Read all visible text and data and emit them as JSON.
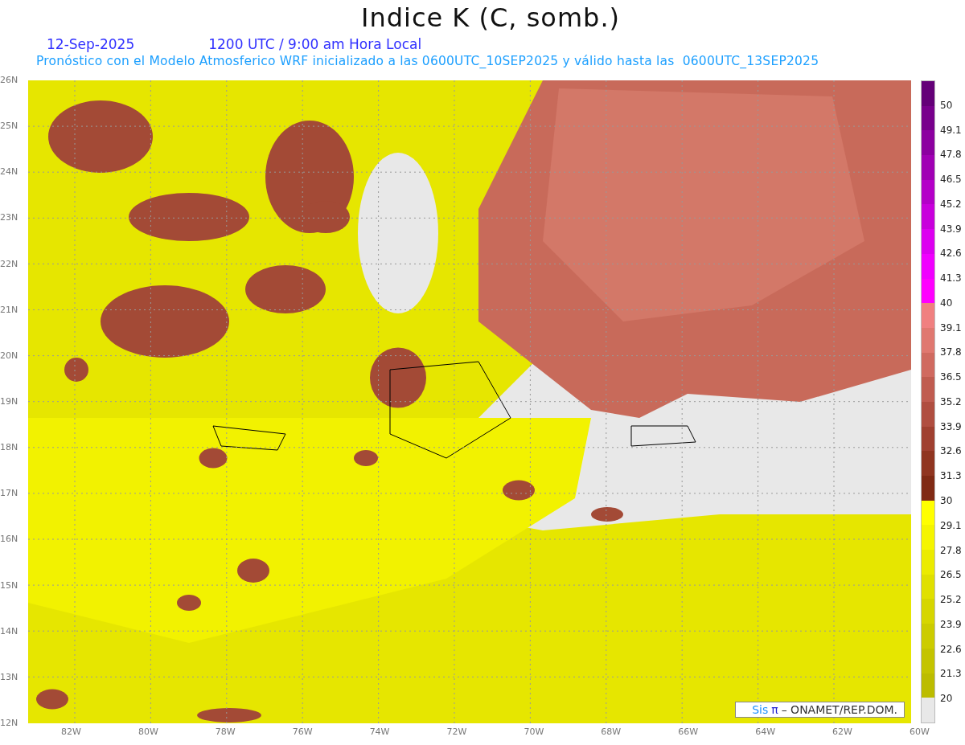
{
  "title": "Indice K (C, somb.)",
  "date": "12-Sep-2025",
  "time": "1200 UTC / 9:00 am Hora Local",
  "subtitle": "Pronóstico con el Modelo Atmosferico WRF inicializado a las 0600UTC_10SEP2025 y válido hasta las  0600UTC_13SEP2025",
  "lat_ticks": [
    "26N",
    "25N",
    "24N",
    "23N",
    "22N",
    "21N",
    "20N",
    "19N",
    "18N",
    "17N",
    "16N",
    "15N",
    "14N",
    "13N",
    "12N"
  ],
  "lon_ticks": [
    "82W",
    "80W",
    "78W",
    "76W",
    "74W",
    "72W",
    "70W",
    "68W",
    "66W",
    "64W",
    "62W",
    "60W"
  ],
  "credit": {
    "brand": "Sis",
    "symbol": "π",
    "text": "–  ONAMET/REP.DOM."
  },
  "legend": {
    "labels": [
      "50",
      "49.1",
      "47.8",
      "46.5",
      "45.2",
      "43.9",
      "42.6",
      "41.3",
      "40",
      "39.1",
      "37.8",
      "36.5",
      "35.2",
      "33.9",
      "32.6",
      "31.3",
      "30",
      "29.1",
      "27.8",
      "26.5",
      "25.2",
      "23.9",
      "22.6",
      "21.3",
      "20"
    ],
    "bins": [
      {
        "color": "#640078"
      },
      {
        "color": "#78008c"
      },
      {
        "color": "#8c00a0"
      },
      {
        "color": "#a000b4"
      },
      {
        "color": "#b400c8"
      },
      {
        "color": "#c800dc"
      },
      {
        "color": "#dc00f0"
      },
      {
        "color": "#f000ff"
      },
      {
        "color": "#ff00ff"
      },
      {
        "color": "#f08080"
      },
      {
        "color": "#e07870"
      },
      {
        "color": "#d06a60"
      },
      {
        "color": "#c05c50"
      },
      {
        "color": "#b04e40"
      },
      {
        "color": "#a04030"
      },
      {
        "color": "#903520"
      },
      {
        "color": "#802a14"
      },
      {
        "color": "#ffff00"
      },
      {
        "color": "#f5f500"
      },
      {
        "color": "#ebeb00"
      },
      {
        "color": "#e0e000"
      },
      {
        "color": "#d6d600"
      },
      {
        "color": "#cccc00"
      },
      {
        "color": "#c4c400"
      },
      {
        "color": "#bcbc00"
      },
      {
        "color": "#e8e8e8"
      }
    ]
  }
}
